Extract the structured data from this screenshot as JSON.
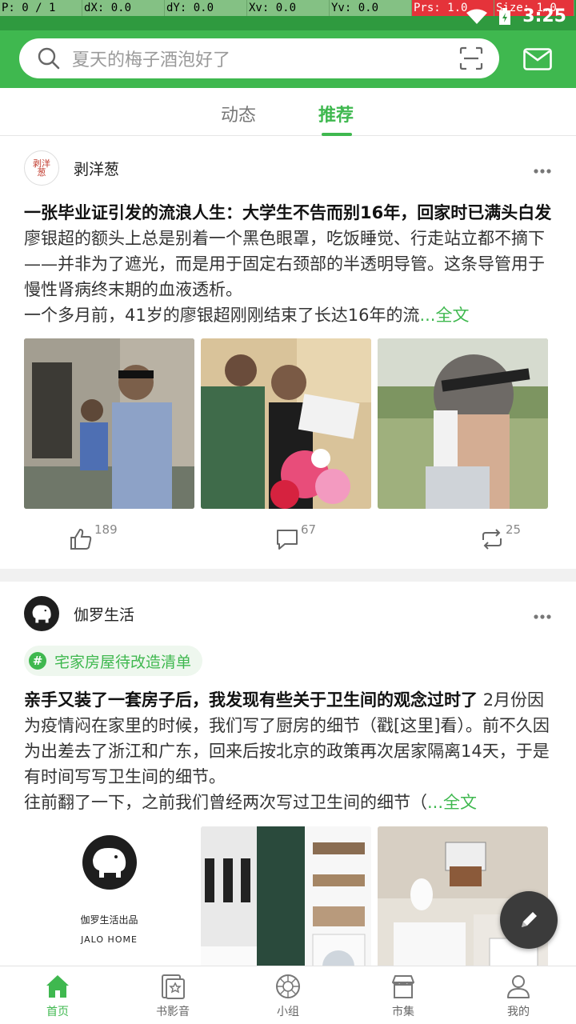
{
  "debug": {
    "p": "P: 0 / 1",
    "dx": "dX: 0.0",
    "dy": "dY: 0.0",
    "xv": "Xv: 0.0",
    "yv": "Yv: 0.0",
    "prs": "Prs: 1.0",
    "size": "Size: 1.0"
  },
  "status_bar": {
    "time": "3:25"
  },
  "search": {
    "placeholder": "夏天的梅子酒泡好了"
  },
  "tabs": [
    {
      "label": "动态",
      "active": false
    },
    {
      "label": "推荐",
      "active": true
    }
  ],
  "posts": [
    {
      "author": "剥洋葱",
      "avatar_text": "剥洋葱",
      "title": "一张毕业证引发的流浪人生：大学生不告而别16年，回家时已满头白发",
      "body": "廖银超的额头上总是别着一个黑色眼罩，吃饭睡觉、行走站立都不摘下——并非为了遮光，而是用于固定右颈部的半透明导管。这条导管用于慢性肾病终末期的血液透析。",
      "body2": "一个多月前，41岁的廖银超刚刚结束了长达16年的流",
      "more": "...全文",
      "likes": "189",
      "comments": "67",
      "reposts": "25"
    },
    {
      "author": "伽罗生活",
      "topic": "宅家房屋待改造清单",
      "title": "亲手又装了一套房子后，我发现有些关于卫生间的观念过时了",
      "body": "2月份因为疫情闷在家里的时候，我们写了厨房的细节（戳[这里]看）。前不久因为出差去了浙江和广东，回来后按北京的政策再次居家隔离14天，于是有时间写写卫生间的细节。",
      "body2": "往前翻了一下，之前我们曾经两次写过卫生间的细节（",
      "more": "...全文",
      "image1_caption": "伽罗生活出品",
      "image1_sub": "JALO HOME"
    }
  ],
  "bottom_nav": [
    {
      "label": "首页",
      "icon": "home-icon",
      "active": true
    },
    {
      "label": "书影音",
      "icon": "book-movie-icon",
      "active": false
    },
    {
      "label": "小组",
      "icon": "group-icon",
      "active": false
    },
    {
      "label": "市集",
      "icon": "market-icon",
      "active": false
    },
    {
      "label": "我的",
      "icon": "profile-icon",
      "active": false
    }
  ],
  "colors": {
    "brand": "#3fb84f",
    "status_bar": "#2f9a3f"
  }
}
